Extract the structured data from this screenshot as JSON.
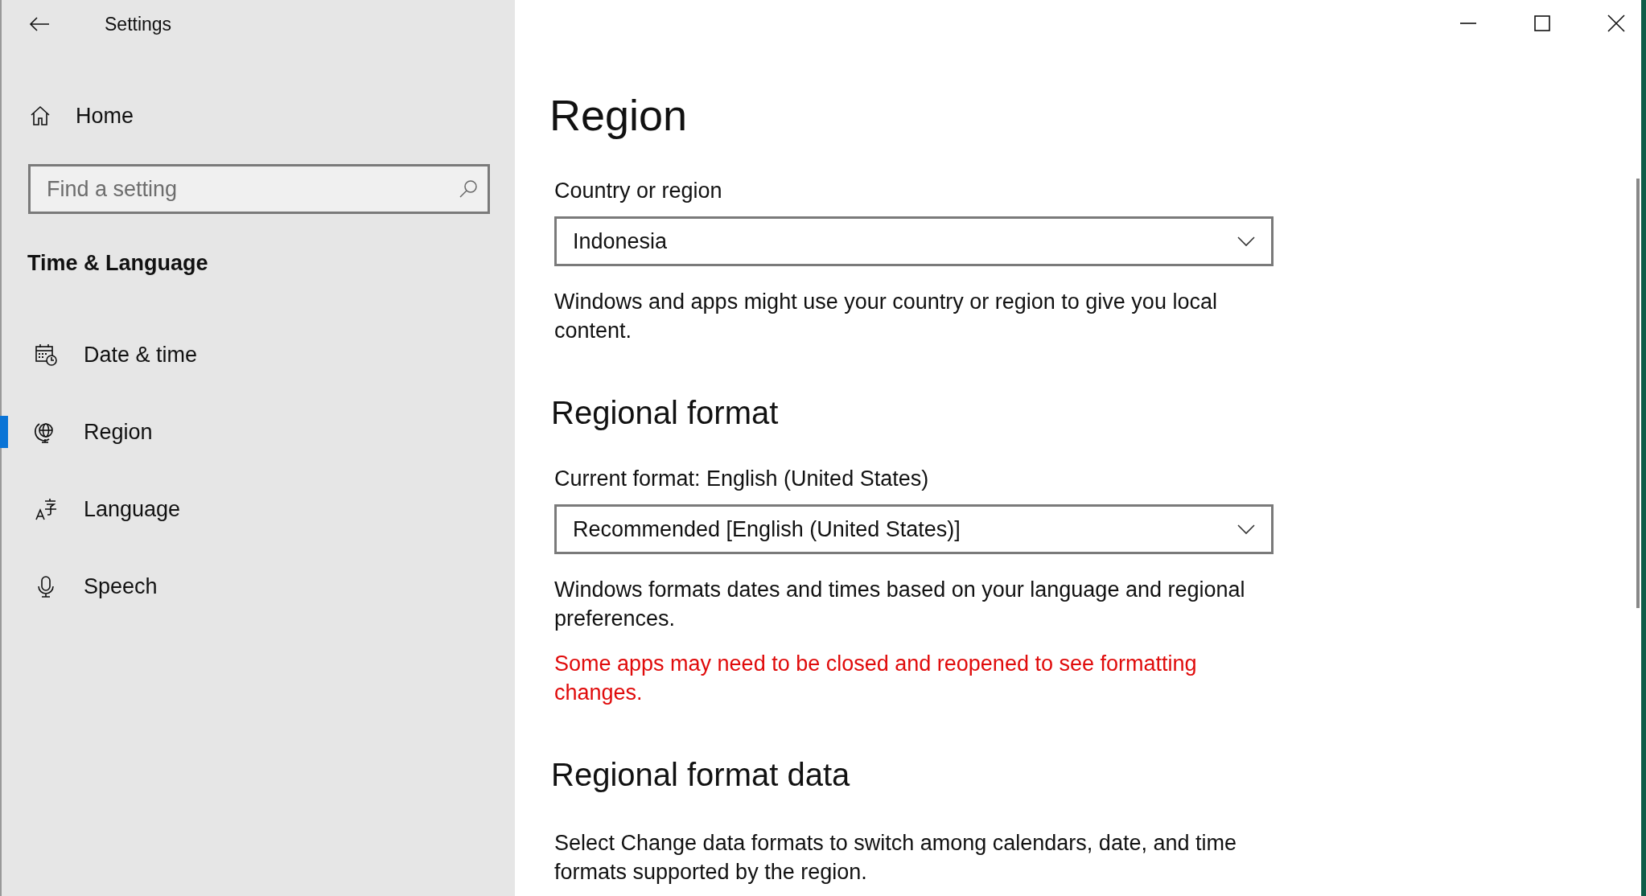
{
  "window": {
    "title": "Settings"
  },
  "sidebar": {
    "home": "Home",
    "search": {
      "placeholder": "Find a setting"
    },
    "section": "Time & Language",
    "items": [
      {
        "label": "Date & time",
        "selected": false
      },
      {
        "label": "Region",
        "selected": true
      },
      {
        "label": "Language",
        "selected": false
      },
      {
        "label": "Speech",
        "selected": false
      }
    ]
  },
  "page": {
    "title": "Region",
    "blocks": [
      {
        "kind": "label",
        "text": "Country or region"
      },
      {
        "kind": "dropdown",
        "value": "Indonesia"
      },
      {
        "kind": "text",
        "text": "Windows and apps might use your country or region to give you local content."
      },
      {
        "kind": "heading",
        "text": "Regional format"
      },
      {
        "kind": "label",
        "text": "Current format: English (United States)"
      },
      {
        "kind": "dropdown",
        "value": "Recommended [English (United States)]"
      },
      {
        "kind": "text",
        "text": "Windows formats dates and times based on your language and regional preferences."
      },
      {
        "kind": "warning",
        "text": "Some apps may need to be closed and reopened to see formatting changes."
      },
      {
        "kind": "heading",
        "text": "Regional format data"
      },
      {
        "kind": "text",
        "text": "Select Change data formats to switch among calendars, date, and time formats supported by the region."
      }
    ]
  }
}
